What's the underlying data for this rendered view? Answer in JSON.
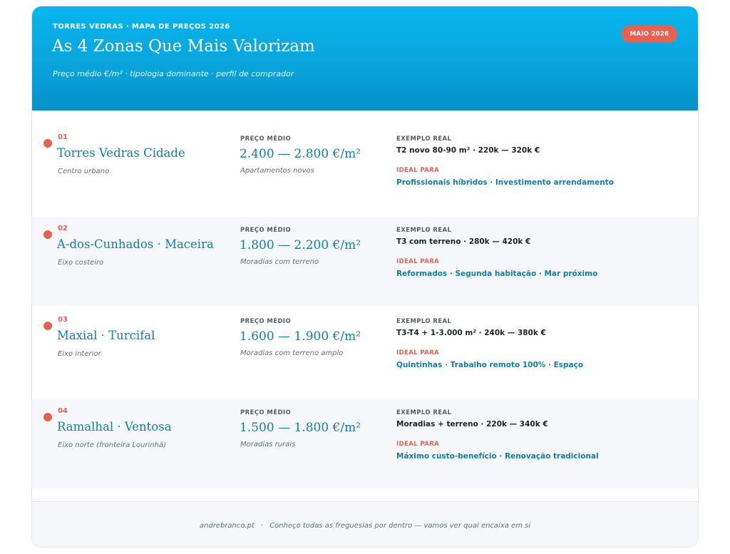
{
  "header": {
    "eyebrow": "TORRES VEDRAS · MAPA DE PREÇOS 2026",
    "title": "As 4 Zonas Que Mais Valorizam",
    "subtitle": "Preço médio €/m² · tipologia dominante · perfil de comprador",
    "badge": "MAIO 2026"
  },
  "labels": {
    "price": "PREÇO MÉDIO",
    "example": "EXEMPLO REAL",
    "ideal": "IDEAL PARA"
  },
  "zones": [
    {
      "number": "01",
      "name": "Torres Vedras Cidade",
      "sub": "Centro urbano",
      "price": "2.400 — 2.800 €/m²",
      "price_desc": "Apartamentos novos",
      "example": "T2 novo 80-90 m² · 220k — 320k €",
      "ideal": "Profissionais híbridos · Investimento arrendamento"
    },
    {
      "number": "02",
      "name": "A-dos-Cunhados · Maceira",
      "sub": "Eixo costeiro",
      "price": "1.800 — 2.200 €/m²",
      "price_desc": "Moradias com terreno",
      "example": "T3 com terreno · 280k — 420k €",
      "ideal": "Reformados · Segunda habitação · Mar próximo"
    },
    {
      "number": "03",
      "name": "Maxial · Turcifal",
      "sub": "Eixo interior",
      "price": "1.600 — 1.900 €/m²",
      "price_desc": "Moradias com terreno amplo",
      "example": "T3-T4 + 1-3.000 m² · 240k — 380k €",
      "ideal": "Quintinhas · Trabalho remoto 100% · Espaço"
    },
    {
      "number": "04",
      "name": "Ramalhal · Ventosa",
      "sub": "Eixo norte (fronteira Lourinhã)",
      "price": "1.500 — 1.800 €/m²",
      "price_desc": "Moradias rurais",
      "example": "Moradias + terreno · 220k — 340k €",
      "ideal": "Máximo custo-benefício · Renovação tradicional"
    }
  ],
  "footer": {
    "site": "andrebranco.pt",
    "separator": "·",
    "message": "Conheço todas as freguesias por dentro — vamos ver qual encaixa em si"
  },
  "colors": {
    "header_gradient_top": "#07b6ee",
    "header_gradient_bottom": "#0592c9",
    "accent_coral": "#e8614f",
    "accent_teal": "#0e7fa6"
  }
}
